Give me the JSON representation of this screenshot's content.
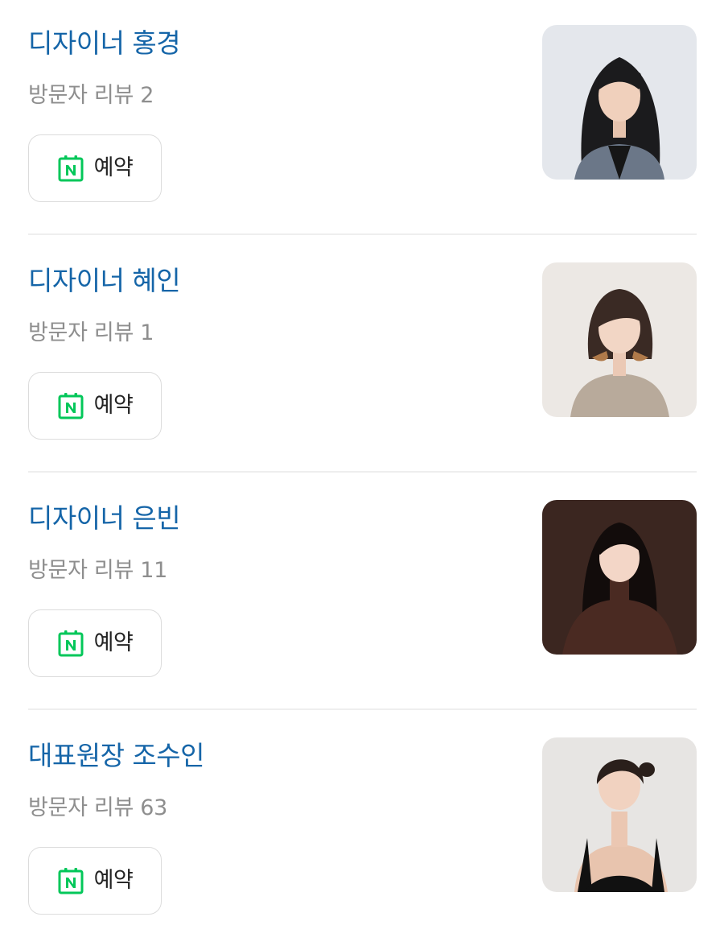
{
  "designers": [
    {
      "name": "디자이너 홍경",
      "reviews_label": "방문자 리뷰",
      "reviews_count": "2",
      "book_label": "예약",
      "photo_icon": "person-portrait",
      "photo_bg": "#e4e7ec"
    },
    {
      "name": "디자이너 혜인",
      "reviews_label": "방문자 리뷰",
      "reviews_count": "1",
      "book_label": "예약",
      "photo_icon": "person-portrait",
      "photo_bg": "#ece8e4"
    },
    {
      "name": "디자이너 은빈",
      "reviews_label": "방문자 리뷰",
      "reviews_count": "11",
      "book_label": "예약",
      "photo_icon": "person-portrait",
      "photo_bg": "#3b2620"
    },
    {
      "name": "대표원장 조수인",
      "reviews_label": "방문자 리뷰",
      "reviews_count": "63",
      "book_label": "예약",
      "photo_icon": "person-portrait",
      "photo_bg": "#e7e5e3"
    }
  ],
  "colors": {
    "name_text": "#1565a8",
    "review_text": "#8e8e8e",
    "naver_green": "#03c75a",
    "divider": "#eeeeee"
  },
  "icons": {
    "booking_icon": "naver-calendar-icon"
  }
}
